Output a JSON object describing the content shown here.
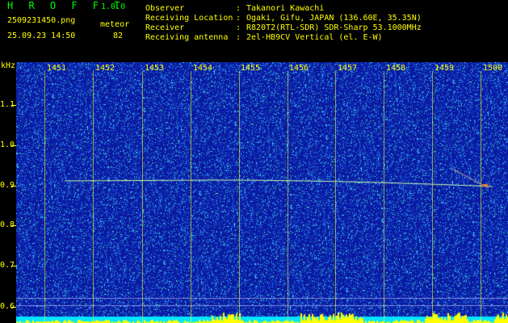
{
  "app": {
    "title": "H R O F F T",
    "version": "1.0.0"
  },
  "capture": {
    "filename": "2509231450.png",
    "datetime": "25.09.23 14:50",
    "meteor_label": "meteor",
    "meteor_count": "82"
  },
  "station": [
    {
      "key": "Observer",
      "sep": ":",
      "value": "Takanori Kawachi"
    },
    {
      "key": "Receiving Location",
      "sep": ":",
      "value": "Ogaki, Gifu, JAPAN (136.60E, 35.35N)"
    },
    {
      "key": "Receiver",
      "sep": ":",
      "value": "R820T2(RTL-SDR) SDR-Sharp 53.1000MHz"
    },
    {
      "key": "Receiving antenna",
      "sep": ":",
      "value": "2el-HB9CV Vertical (el. E-W)"
    }
  ],
  "spectrogram": {
    "y_unit": "kHz",
    "x_ticks": [
      "1451",
      "1452",
      "1453",
      "1454",
      "1455",
      "1456",
      "1457",
      "1458",
      "1459",
      "1500"
    ],
    "y_ticks": [
      "1.1",
      "1.0",
      "0.9",
      "0.8",
      "0.7",
      "0.6"
    ],
    "colors": {
      "background": "#0a1aa0",
      "noise_cyan": "#3fd7ff",
      "noise_green": "#4cff6c",
      "trace": "#c8ffb0",
      "bottom_band": "#00e5ff",
      "bottom_peaks": "#ffff00",
      "axis_text": "#ffff00",
      "header_text": "#ffff00",
      "title_text": "#00ff00"
    }
  }
}
